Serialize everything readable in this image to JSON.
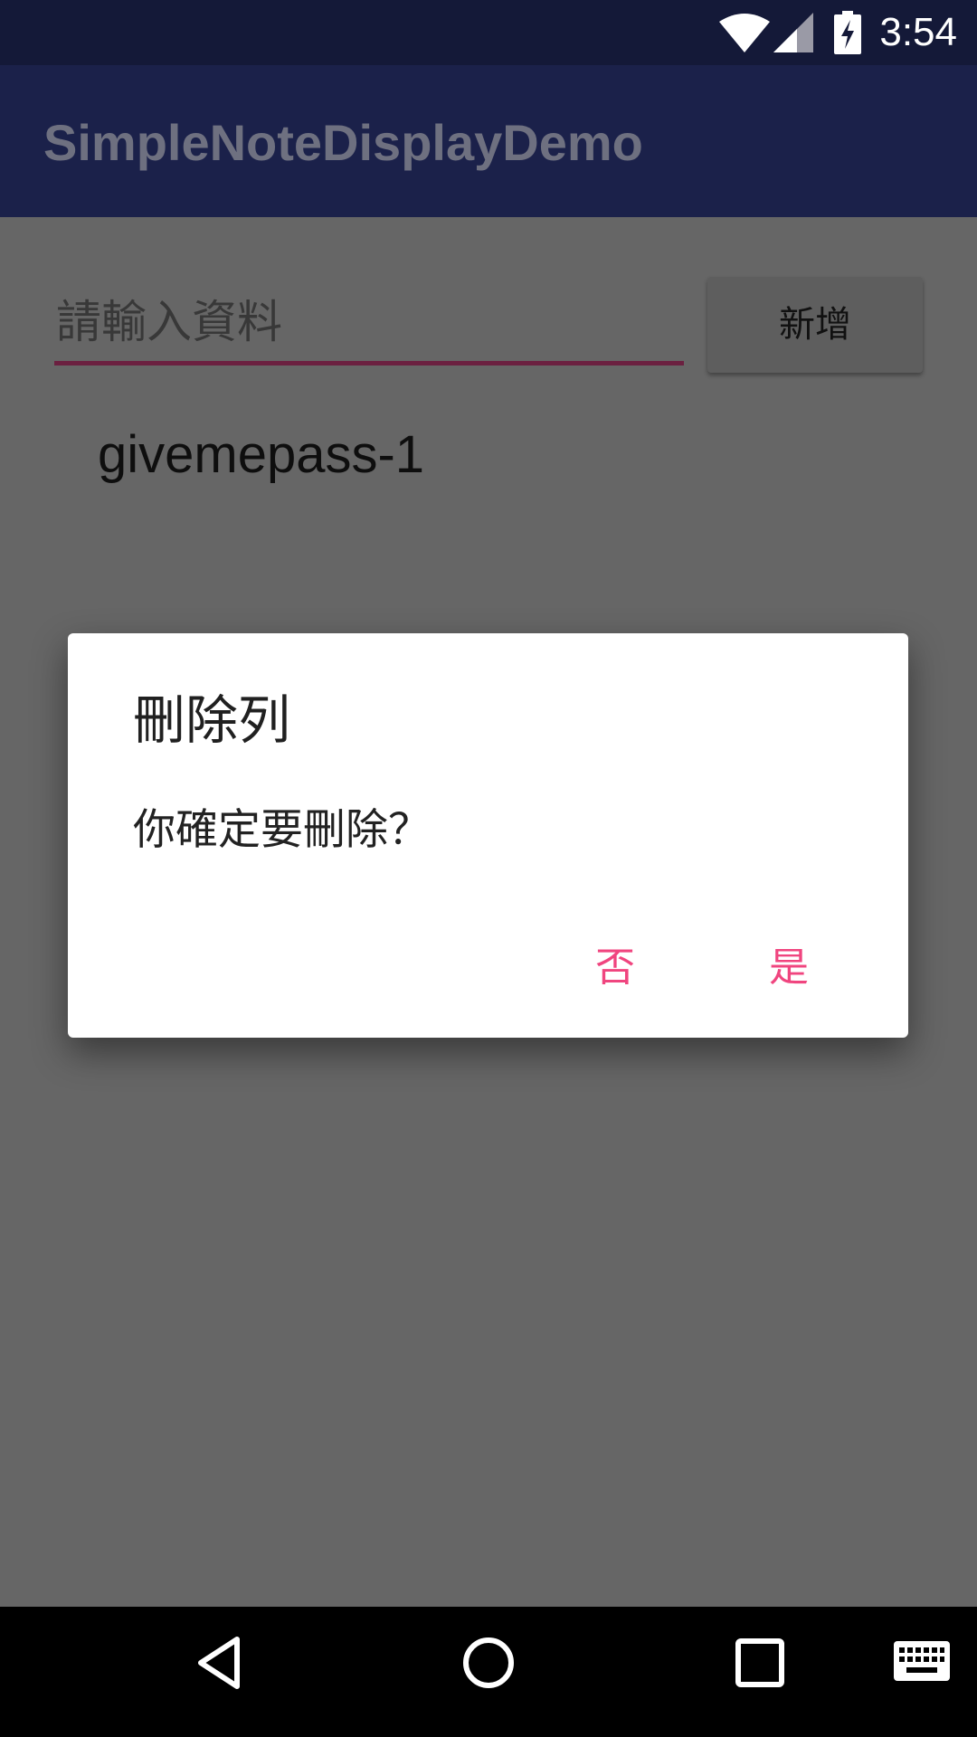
{
  "status_bar": {
    "time": "3:54",
    "icons": [
      "wifi-icon",
      "cell-signal-icon",
      "battery-charging-icon"
    ]
  },
  "app_bar": {
    "title": "SimpleNoteDisplayDemo"
  },
  "form": {
    "input_placeholder": "請輸入資料",
    "add_button_label": "新增"
  },
  "list": {
    "items": [
      "givemepass-1"
    ]
  },
  "dialog": {
    "title": "刪除列",
    "message": "你確定要刪除？",
    "negative_label": "否",
    "positive_label": "是",
    "accent_color": "#f0457f"
  },
  "nav_bar": {
    "icons": [
      "back-icon",
      "home-icon",
      "recents-icon",
      "keyboard-icon"
    ]
  },
  "colors": {
    "status_bar": "#141938",
    "app_bar": "#1b214a",
    "scrim_background": "#666666",
    "input_underline": "#6b2040"
  }
}
